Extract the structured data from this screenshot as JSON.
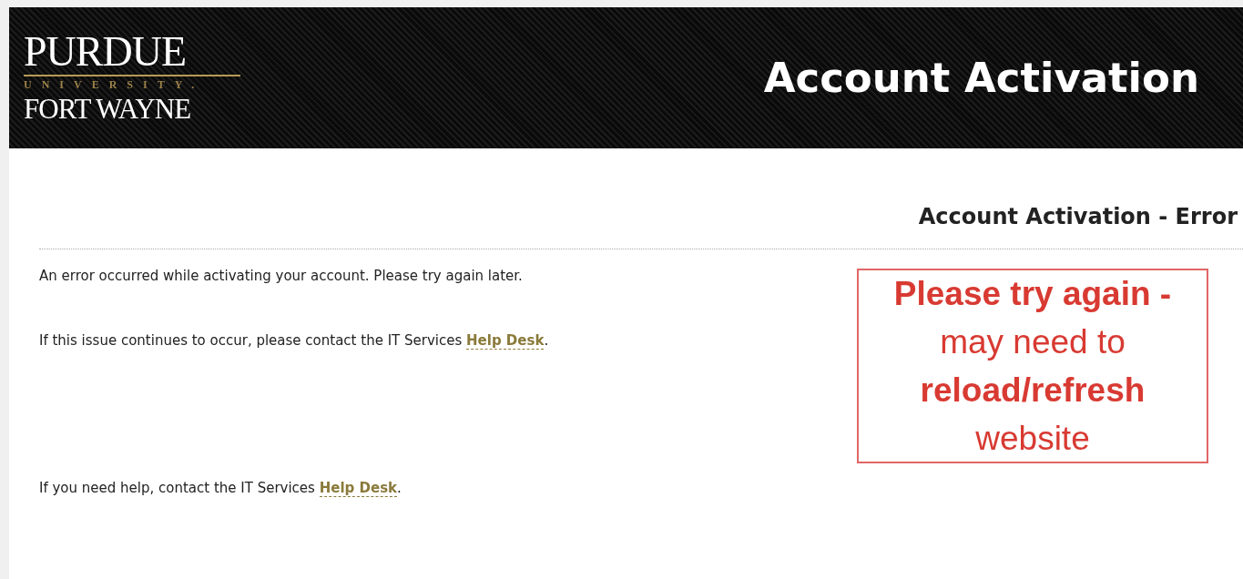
{
  "header": {
    "logo": {
      "name": "PURDUE",
      "subtitle": "UNIVERSITY.",
      "campus": "FORT WAYNE"
    },
    "title": "Account Activation"
  },
  "content": {
    "heading": "Account Activation - Error",
    "paragraphs": [
      {
        "text": "An error occurred while activating your account. Please try again later."
      },
      {
        "text": "If this issue continues to occur, please contact the IT Services ",
        "link": "Help Desk",
        "after": "."
      }
    ],
    "footer_note": {
      "text": "If you need help, contact the IT Services ",
      "link": "Help Desk",
      "after": "."
    }
  },
  "annotation": {
    "lines": [
      {
        "text": "Please try again -",
        "bold": true
      },
      {
        "text": "may need to",
        "bold": false
      },
      {
        "text": "reload/refresh",
        "bold": true
      },
      {
        "text": "website",
        "bold": false
      }
    ]
  }
}
